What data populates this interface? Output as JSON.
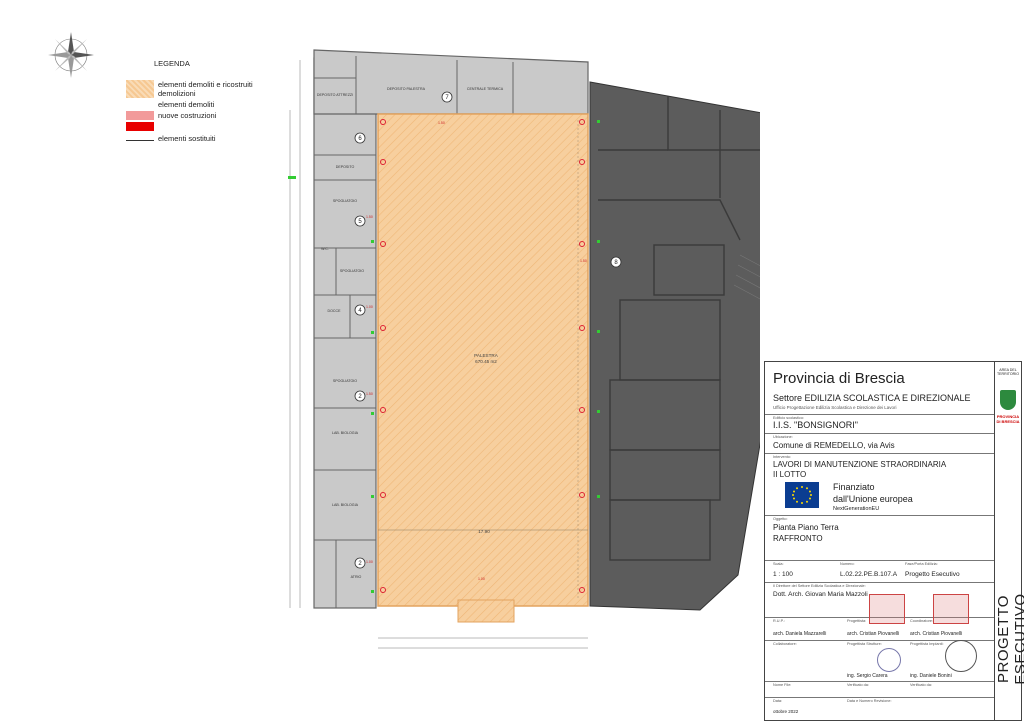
{
  "legend": {
    "title": "LEGENDA",
    "items": [
      {
        "label": "elementi demoliti e ricostruiti",
        "color": "#f6c892"
      },
      {
        "label": "demolizioni",
        "color": "#f7eab2"
      },
      {
        "label": "elementi demoliti",
        "color": "#ffffff"
      },
      {
        "label": "nuove costruzioni",
        "color": "#f29a9a"
      },
      {
        "label": "elementi sostituiti",
        "color": "#e80000"
      }
    ]
  },
  "plan": {
    "gym_label": "PALESTRA",
    "gym_area": "670.45 m2",
    "width_dim": "17.90",
    "rooms": [
      "DEPOSITO PALESTRA",
      "CENTRALE TERMICA",
      "DEPOSITO ATTREZZI",
      "DEPOSITO",
      "SPOGLIATOIO",
      "W.C.",
      "DOCCE",
      "SPOGLIATOIO",
      "SPOGLIATOIO",
      "LAB. BIOLOGIA",
      "LAB. BIOLOGIA",
      "ATRIO",
      "RIPOSTIGLIO"
    ],
    "room_numbers": [
      "7",
      "6",
      "5",
      "4",
      "3",
      "2",
      "8"
    ]
  },
  "title_block": {
    "province": "Provincia di Brescia",
    "sector": "Settore EDILIZIA SCOLASTICA E DIREZIONALE",
    "office": "Ufficio Progettazione Edilizia Scolastica e Direzione dei Lavori",
    "school_label": "Edificio scolastico:",
    "school": "I.I.S. \"BONSIGNORI\"",
    "location_label": "Ubicazione:",
    "location": "Comune di REMEDELLO, via Avis",
    "work_label": "Intervento:",
    "work_1": "LAVORI DI MANUTENZIONE STRAORDINARIA",
    "work_2": "II LOTTO",
    "funding_1": "Finanziato",
    "funding_2": "dall'Unione europea",
    "funding_3": "NextGenerationEU",
    "object_label": "Oggetto:",
    "object_1": "Pianta Piano Terra",
    "object_2": "RAFFRONTO",
    "scale_label": "Scala:",
    "scale": "1 : 100",
    "number_label": "Numero:",
    "number": "L.02.22.PE.B.107.A",
    "phase_label": "Fase/Porta Edilizia:",
    "phase": "Progetto  Esecutivo",
    "director_label": "Il Direttore del Settore Edilizia Scolastica e Direzionale:",
    "director": "Dott. Arch. Giovan Maria Mazzoli",
    "rup_label": "R.U.P.:",
    "rup": "arch. Daniela Mazzarelli",
    "designer_label": "Progettista:",
    "designer": "arch. Cristian Piovanelli",
    "coordinator_label": "Coordinatore:",
    "coordinator": "arch. Cristian Piovanelli",
    "collab_label": "Collaboratore:",
    "structures_label": "Progettista Strutture:",
    "structures": "ing. Sergio Carera",
    "plants_label": "Progettista Impianti:",
    "plants": "ing. Daniele Bonini",
    "file_label": "Nome File:",
    "verified_label": "Verificato da:",
    "checked_label": "Verificato da:",
    "date_label": "Data:",
    "date": "ottobre 2022",
    "revision_label": "Data e Numero Revisione:",
    "area_label": "AREA DEL TERRITORIO",
    "logo_text": "PROVINCIA DI BRESCIA",
    "stage": "PROGETTO ESECUTIVO"
  }
}
